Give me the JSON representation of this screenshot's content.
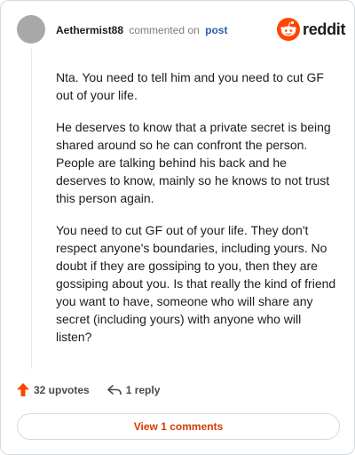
{
  "comment": {
    "username": "Aethermist88",
    "action_text": "commented on",
    "post_link": "post",
    "paragraphs": [
      "Nta. You need to tell him and you need to cut GF out of your life.",
      "He deserves to know that a private secret is being shared around so he can confront the person. People are talking behind his back and he deserves to know, mainly so he knows to not trust this person again.",
      "You need to cut GF out of your life. They don't respect anyone's boundaries, including yours. No doubt if they are gossiping to you, then they are gossiping about you. Is that really the kind of friend you want to have, someone who will share any secret (including yours) with anyone who will listen?"
    ]
  },
  "brand": {
    "wordmark": "reddit",
    "color": "#ff4500"
  },
  "actions": {
    "upvotes": "32 upvotes",
    "reply": "1 reply",
    "view_comments": "View 1 comments"
  },
  "colors": {
    "accent_orange": "#ff4500",
    "link_blue": "#2a5db0",
    "view_comments_text": "#d93a00"
  },
  "icons": {
    "avatar": "avatar-placeholder",
    "logo": "reddit-snoo-icon",
    "upvote": "upvote-arrow-icon",
    "reply": "reply-arrow-icon"
  }
}
